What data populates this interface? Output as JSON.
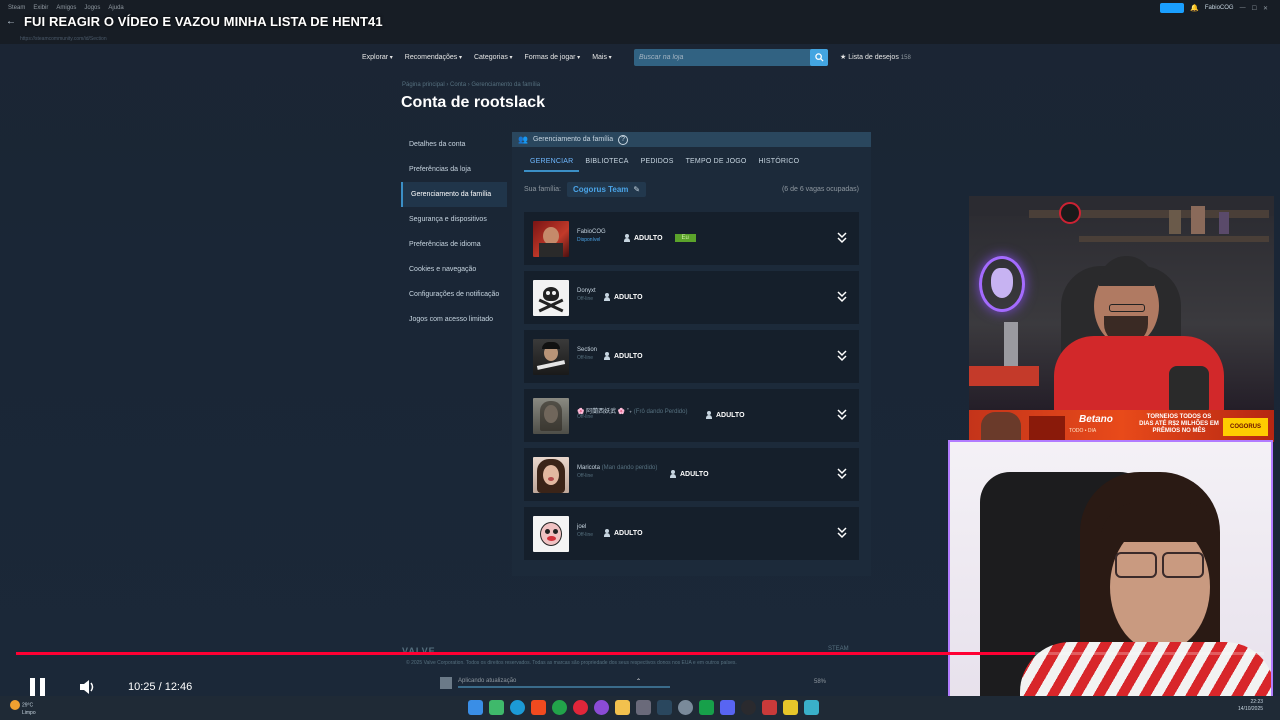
{
  "video": {
    "title": "FUI REAGIR O VÍDEO E VAZOU MINHA LISTA DE HENT41",
    "time": "10:25 / 12:46",
    "progress": 0.8167
  },
  "steam_menu": [
    "Steam",
    "Exibir",
    "Amigos",
    "Jogos",
    "Ajuda"
  ],
  "steam_user": "FabioCOG",
  "url": "https://steamcommunity.com/id/Section",
  "store_nav": [
    "Explorar",
    "Recomendações",
    "Categorias",
    "Formas de jogar",
    "Mais"
  ],
  "search": {
    "placeholder": "Buscar na loja"
  },
  "wishlist": {
    "label": "Lista de desejos",
    "count": "158"
  },
  "breadcrumb": "Página principal › Conta › Gerenciamento da família",
  "page_title": "Conta de rootslack",
  "sidebar": [
    "Detalhes da conta",
    "Preferências da loja",
    "Gerenciamento da família",
    "Segurança e dispositivos",
    "Preferências de idioma",
    "Cookies e navegação",
    "Configurações de notificação",
    "Jogos com acesso limitado"
  ],
  "panel": {
    "header": "Gerenciamento da família",
    "tabs": [
      "GERENCIAR",
      "BIBLIOTECA",
      "PEDIDOS",
      "TEMPO DE JOGO",
      "HISTÓRICO"
    ],
    "family_label": "Sua família:",
    "family_name": "Cogorus Team",
    "slots": "(6 de 6 vagas ocupadas)"
  },
  "members": [
    {
      "name": "FabioCOG",
      "extra": "",
      "status": "Disponível",
      "role": "ADULTO",
      "badge": "Eu"
    },
    {
      "name": "Donyxt",
      "extra": "",
      "status": "Off-line",
      "role": "ADULTO",
      "badge": ""
    },
    {
      "name": "Section",
      "extra": "",
      "status": "Off-line",
      "role": "ADULTO",
      "badge": ""
    },
    {
      "name": "🌸 阿蘭西妖武 🌸 ˚₊",
      "extra": " (Frô dando Perdido)",
      "status": "Off-line",
      "role": "ADULTO",
      "badge": ""
    },
    {
      "name": "Maricota",
      "extra": " (Man dando perdido)",
      "status": "Off-line",
      "role": "ADULTO",
      "badge": ""
    },
    {
      "name": "joel",
      "extra": "",
      "status": "Off-line",
      "role": "ADULTO",
      "badge": ""
    }
  ],
  "footer": {
    "valve": "VALVE",
    "steam": "STEAM",
    "copyright": "© 2025 Valve Corporation. Todos os direitos reservados. Todas as marcas são propriedade dos seus respectivos donos nos EUA e em outros países."
  },
  "update": {
    "label": "Aplicando atualização",
    "percent": "58%"
  },
  "weather": {
    "temp": "29°C",
    "desc": "Limpo"
  },
  "clock": {
    "time": "22:23",
    "date": "14/10/2025"
  },
  "ad": {
    "brand": "Betano",
    "sub": "TODO • DIA",
    "promo": "TORNEIOS TODOS OS DIAS ATÉ R$2 MILHÕES EM PRÊMIOS NO MÊS",
    "tag": "COGORUS"
  },
  "colors": {
    "accent": "#3b8fc6",
    "progress": "#ff0033",
    "you_badge": "#5ba32b"
  }
}
